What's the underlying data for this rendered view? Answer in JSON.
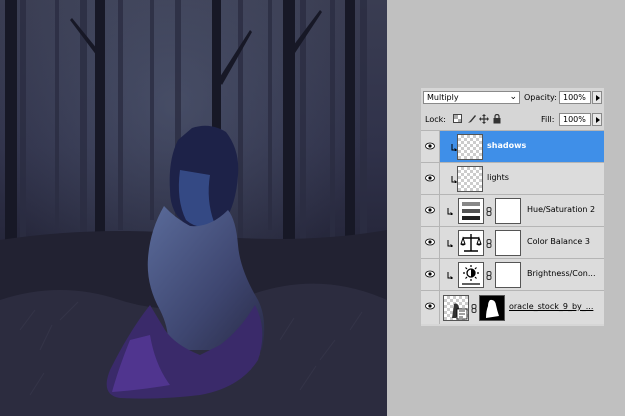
{
  "blend_mode": "Multiply",
  "opacity_label": "Opacity:",
  "opacity_value": "100%",
  "lock_label": "Lock:",
  "fill_label": "Fill:",
  "fill_value": "100%",
  "layers": [
    {
      "name": "shadows",
      "selected": true,
      "type": "pixel",
      "clipped": true
    },
    {
      "name": "lights",
      "selected": false,
      "type": "pixel",
      "clipped": true
    },
    {
      "name": "Hue/Saturation 2",
      "selected": false,
      "type": "adjustment",
      "icon": "hue-saturation-icon",
      "clipped": true
    },
    {
      "name": "Color Balance 3",
      "selected": false,
      "type": "adjustment",
      "icon": "color-balance-icon",
      "clipped": true
    },
    {
      "name": "Brightness/Con...",
      "selected": false,
      "type": "adjustment",
      "icon": "brightness-contrast-icon",
      "clipped": true
    },
    {
      "name": "oracle_stock_9_by_...",
      "selected": false,
      "type": "smart-object-with-mask",
      "clipped": false
    }
  ],
  "colors": {
    "selection": "#3f8fe8",
    "panel": "#d6d6d6",
    "workspace": "#c0c0c0",
    "forest_dark": "#1b1c2c"
  }
}
